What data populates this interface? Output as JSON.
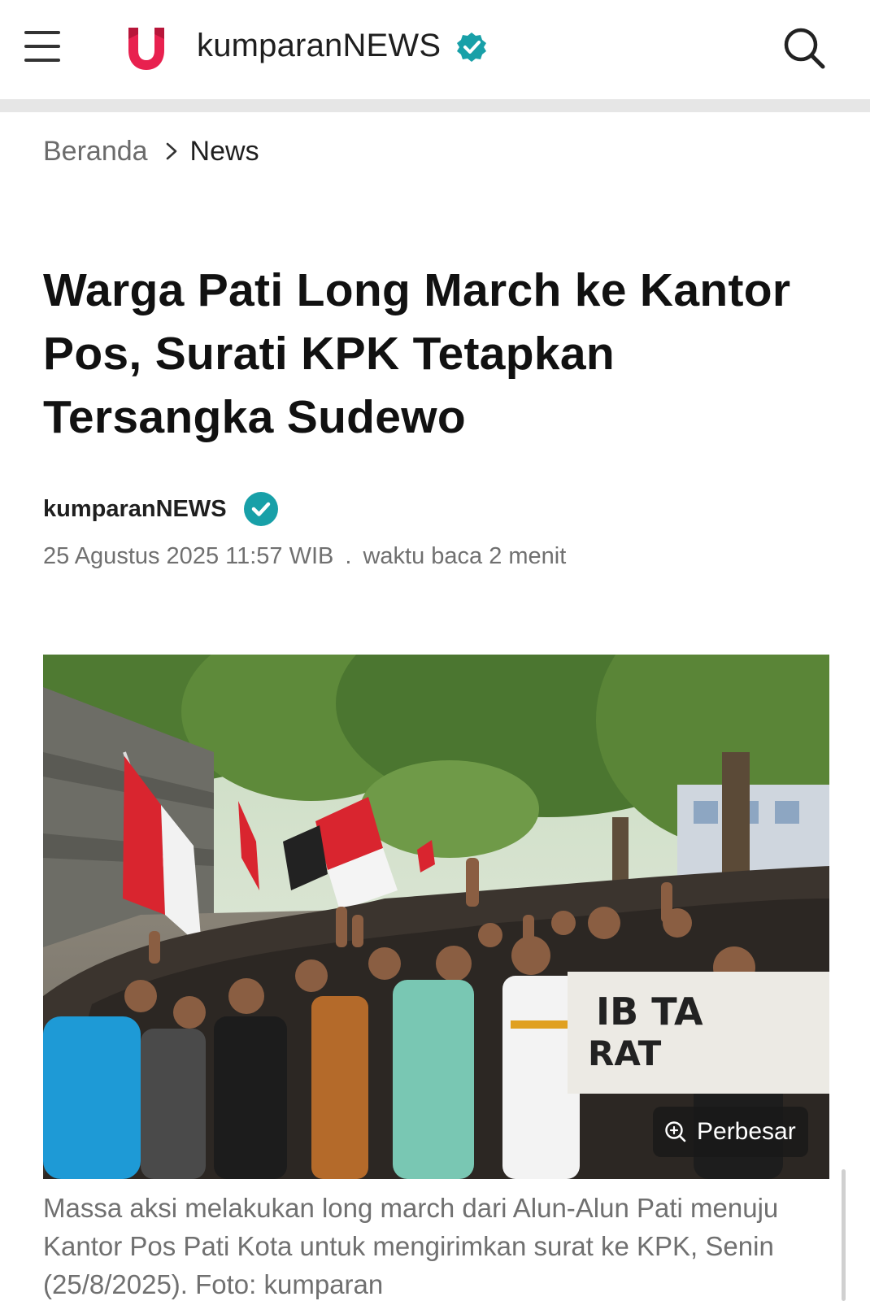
{
  "header": {
    "brand": "kumparanNEWS",
    "menu_icon": "hamburger-menu-icon",
    "search_icon": "search-icon",
    "verified_icon": "verified-check-icon",
    "brand_color": "#e8214f",
    "verified_color": "#18a0a8"
  },
  "breadcrumb": {
    "home": "Beranda",
    "current": "News"
  },
  "article": {
    "title": "Warga Pati Long March ke Kantor Pos, Surati KPK Tetapkan Tersangka Sudewo",
    "author": "kumparanNEWS",
    "date": "25 Agustus 2025 11:57 WIB",
    "separator": ".",
    "read_time": "waktu baca 2 menit",
    "image_zoom_label": "Perbesar",
    "caption": "Massa aksi melakukan long march dari Alun-Alun Pati menuju Kantor Pos Pati Kota untuk mengirimkan surat ke KPK, Senin (25/8/2025).  Foto: kumparan"
  }
}
